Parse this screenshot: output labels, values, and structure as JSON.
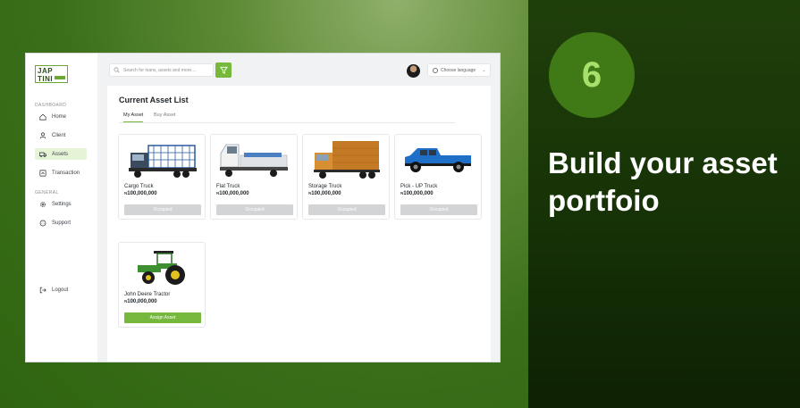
{
  "promo": {
    "step_number": "6",
    "headline": "Build your asset portfoio",
    "colors": {
      "accent": "#75b83b",
      "dark_green": "#173307",
      "circle": "#3f7a16"
    }
  },
  "brand": {
    "logo_line1": "JAP",
    "logo_line2": "TINI"
  },
  "sidebar": {
    "dashboard_label": "DASHBOARD",
    "general_label": "GENERAL",
    "items": [
      {
        "label": "Home",
        "icon": "home-icon"
      },
      {
        "label": "Client",
        "icon": "user-icon"
      },
      {
        "label": "Assets",
        "icon": "truck-icon"
      },
      {
        "label": "Transaction",
        "icon": "transaction-icon"
      },
      {
        "label": "Settings",
        "icon": "gear-icon"
      },
      {
        "label": "Support",
        "icon": "chat-icon"
      }
    ],
    "logout": "Logout"
  },
  "topbar": {
    "search_placeholder": "Search for loans, assets and more....",
    "language_label": "Choose language"
  },
  "main": {
    "title": "Current Asset List",
    "tabs": [
      "My Asset",
      "Buy Asset"
    ],
    "currency_symbol": "₦",
    "assets": [
      {
        "name": "Cargo Truck",
        "price": "100,000,000",
        "action": "Occupied",
        "status": "occupied"
      },
      {
        "name": "Flat Truck",
        "price": "100,000,000",
        "action": "Occupied",
        "status": "occupied"
      },
      {
        "name": "Storage Truck",
        "price": "100,000,000",
        "action": "Occupied",
        "status": "occupied"
      },
      {
        "name": "Pick - UP Truck",
        "price": "100,000,000",
        "action": "Occupied",
        "status": "occupied"
      },
      {
        "name": "John Deere Tractor",
        "price": "100,000,000",
        "action": "Assign Asset",
        "status": "available"
      }
    ]
  }
}
